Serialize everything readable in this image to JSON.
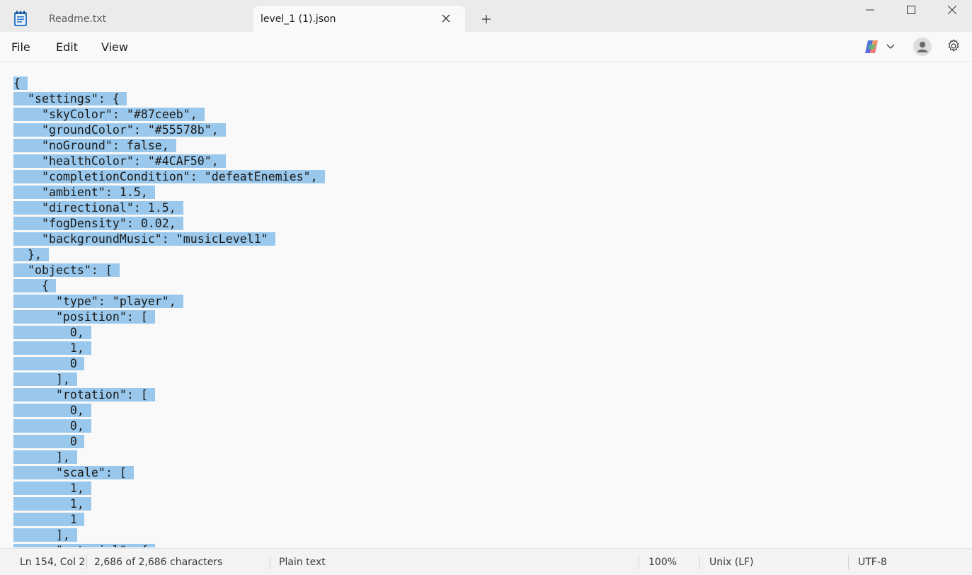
{
  "tabs": [
    {
      "label": "Readme.txt",
      "active": false
    },
    {
      "label": "level_1 (1).json",
      "active": true
    }
  ],
  "menu": {
    "file": "File",
    "edit": "Edit",
    "view": "View"
  },
  "icons": {
    "app": "notepad-icon",
    "tab_close": "close-icon",
    "new_tab": "plus-icon",
    "minimize": "minimize-icon",
    "maximize": "maximize-icon",
    "close": "close-icon",
    "copilot": "copilot-icon",
    "dropdown": "chevron-down-icon",
    "account": "avatar-icon",
    "settings": "gear-icon"
  },
  "editor": {
    "selection_color": "#99c8ec",
    "lines": [
      "{",
      "  \"settings\": {",
      "    \"skyColor\": \"#87ceeb\",",
      "    \"groundColor\": \"#55578b\",",
      "    \"noGround\": false,",
      "    \"healthColor\": \"#4CAF50\",",
      "    \"completionCondition\": \"defeatEnemies\",",
      "    \"ambient\": 1.5,",
      "    \"directional\": 1.5,",
      "    \"fogDensity\": 0.02,",
      "    \"backgroundMusic\": \"musicLevel1\"",
      "  },",
      "  \"objects\": [",
      "    {",
      "      \"type\": \"player\",",
      "      \"position\": [",
      "        0,",
      "        1,",
      "        0",
      "      ],",
      "      \"rotation\": [",
      "        0,",
      "        0,",
      "        0",
      "      ],",
      "      \"scale\": [",
      "        1,",
      "        1,",
      "        1",
      "      ],",
      "      \"material\": {"
    ]
  },
  "status": {
    "position": "Ln 154, Col 2",
    "characters": "2,686 of 2,686 characters",
    "file_type": "Plain text",
    "zoom": "100%",
    "line_ending": "Unix (LF)",
    "encoding": "UTF-8"
  }
}
